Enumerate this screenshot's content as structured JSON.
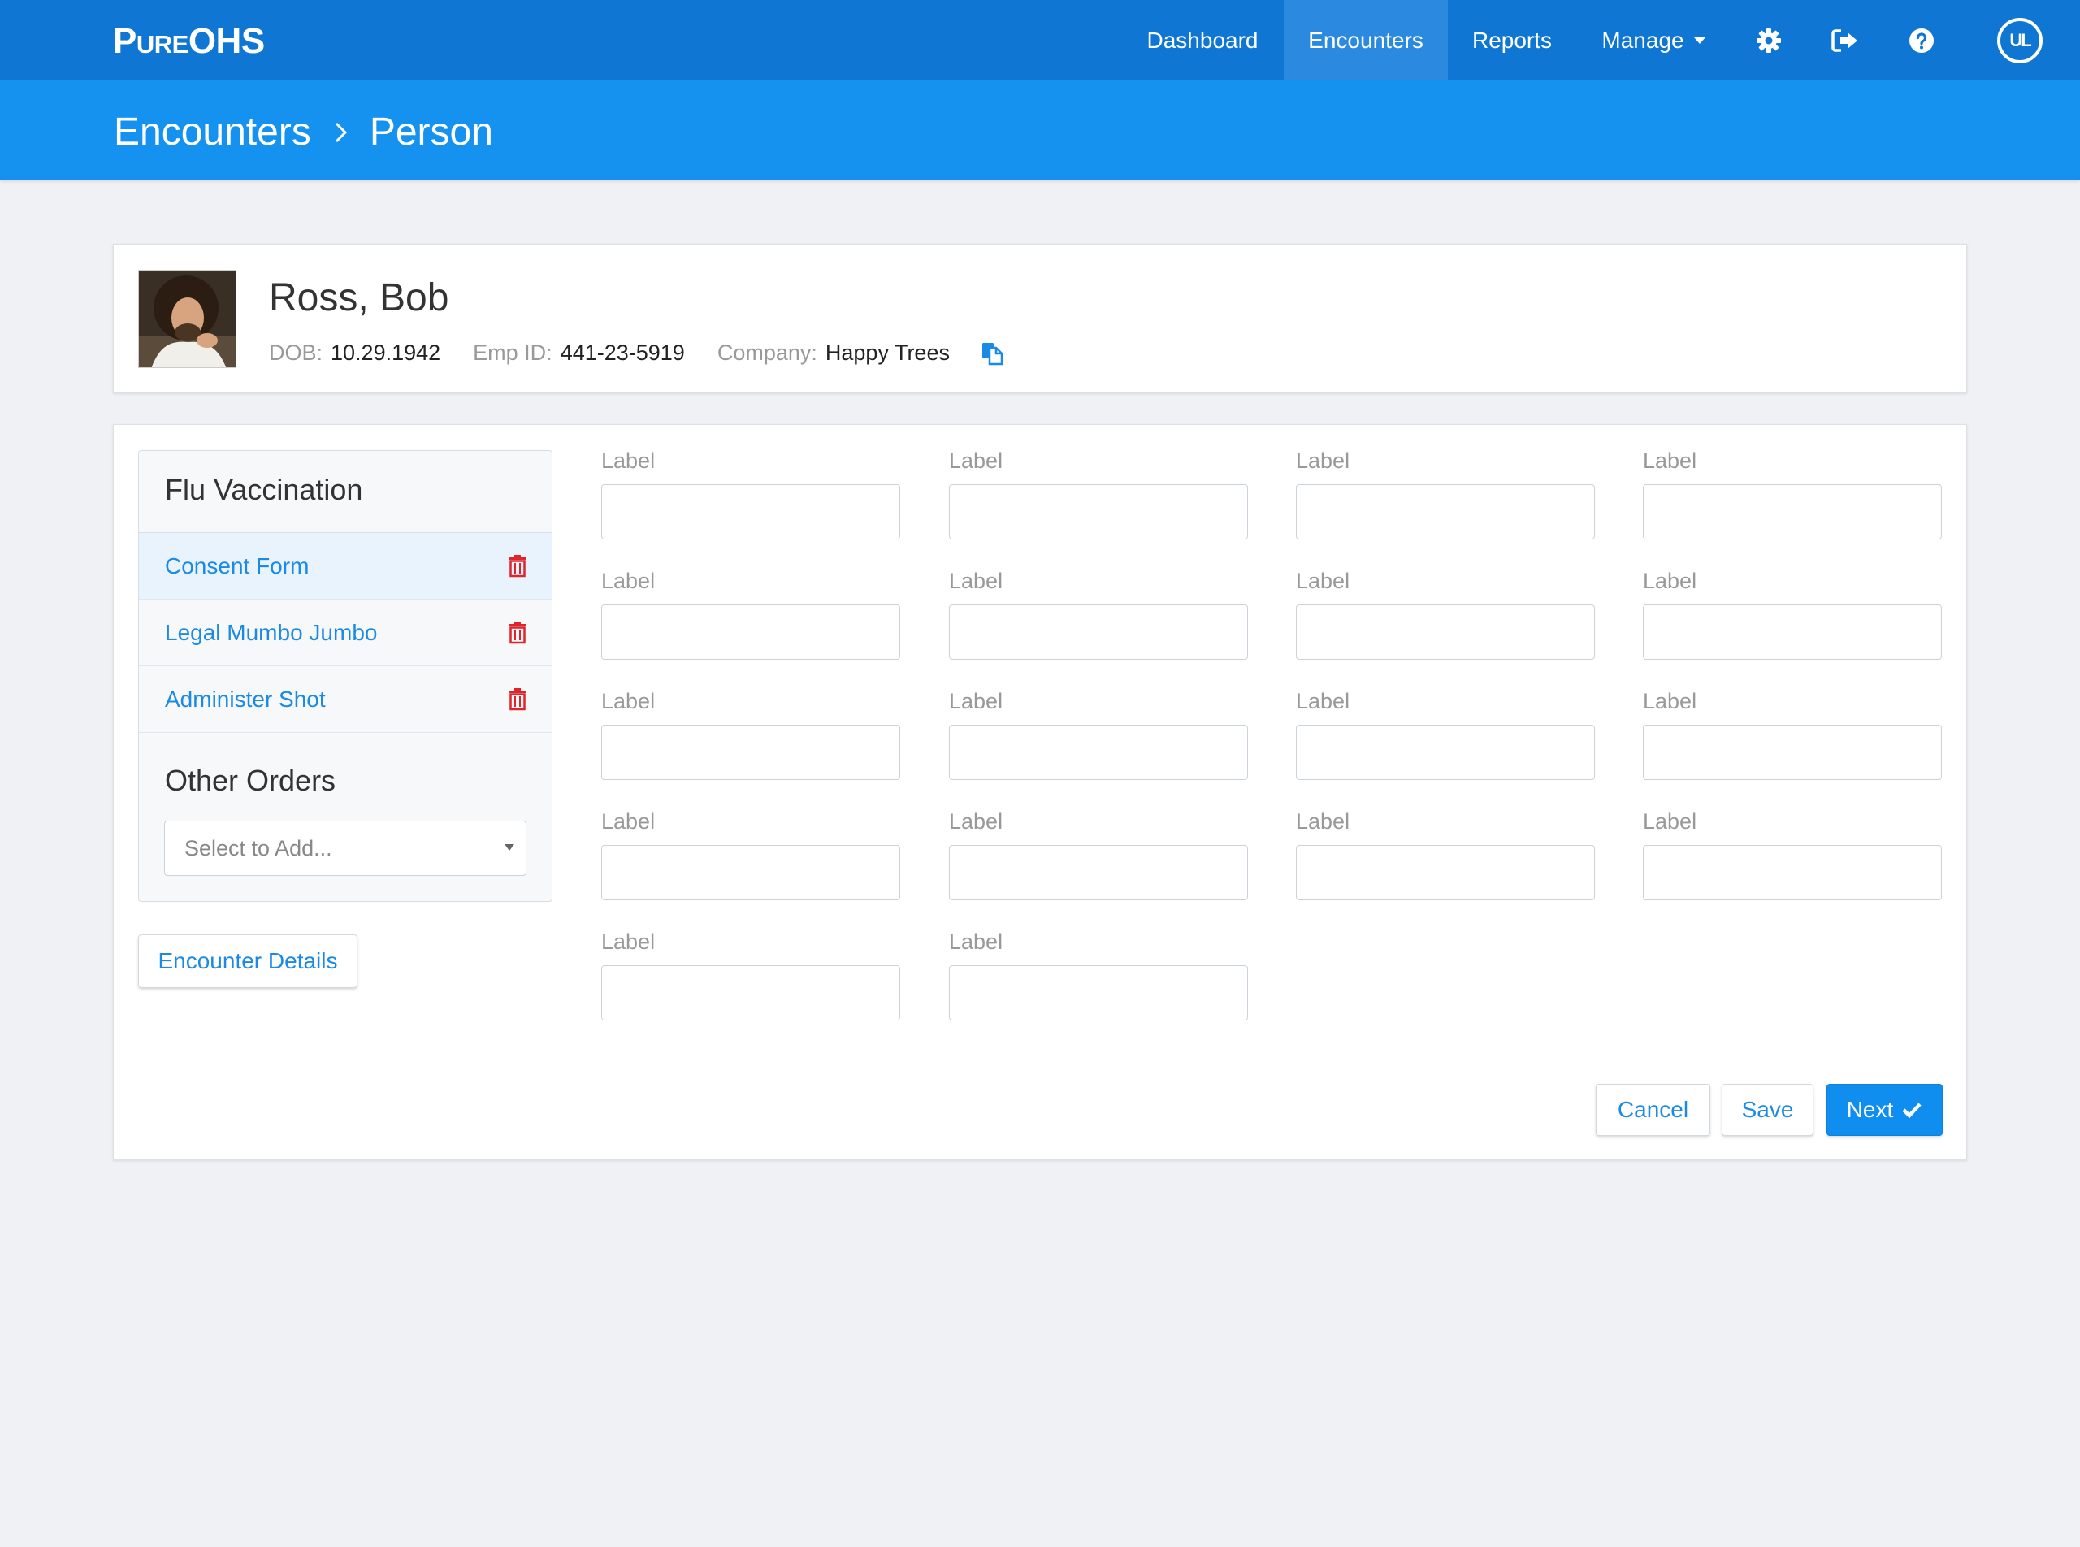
{
  "app": {
    "logo_part1": "Pure",
    "logo_part2": "OHS"
  },
  "nav": {
    "items": [
      {
        "label": "Dashboard"
      },
      {
        "label": "Encounters",
        "active": true
      },
      {
        "label": "Reports"
      },
      {
        "label": "Manage"
      }
    ],
    "icons": [
      "gear-icon",
      "sign-out-icon",
      "help-icon"
    ],
    "badge": "UL"
  },
  "breadcrumb": {
    "items": [
      "Encounters",
      "Person"
    ]
  },
  "person": {
    "name": "Ross, Bob",
    "dob_label": "DOB:",
    "dob": "10.29.1942",
    "emp_label": "Emp ID:",
    "emp_id": "441-23-5919",
    "company_label": "Company:",
    "company": "Happy Trees"
  },
  "orders": {
    "title": "Flu Vaccination",
    "items": [
      {
        "label": "Consent Form",
        "selected": true
      },
      {
        "label": "Legal Mumbo Jumbo"
      },
      {
        "label": "Administer Shot"
      }
    ],
    "other_title": "Other Orders",
    "select_placeholder": "Select to Add..."
  },
  "details_button": "Encounter Details",
  "form": {
    "fields": [
      {
        "label": "Label",
        "value": ""
      },
      {
        "label": "Label",
        "value": ""
      },
      {
        "label": "Label",
        "value": ""
      },
      {
        "label": "Label",
        "value": ""
      },
      {
        "label": "Label",
        "value": ""
      },
      {
        "label": "Label",
        "value": ""
      },
      {
        "label": "Label",
        "value": ""
      },
      {
        "label": "Label",
        "value": ""
      },
      {
        "label": "Label",
        "value": ""
      },
      {
        "label": "Label",
        "value": ""
      },
      {
        "label": "Label",
        "value": ""
      },
      {
        "label": "Label",
        "value": ""
      },
      {
        "label": "Label",
        "value": ""
      },
      {
        "label": "Label",
        "value": ""
      },
      {
        "label": "Label",
        "value": ""
      },
      {
        "label": "Label",
        "value": ""
      },
      {
        "label": "Label",
        "value": ""
      },
      {
        "label": "Label",
        "value": ""
      }
    ]
  },
  "actions": {
    "cancel": "Cancel",
    "save": "Save",
    "next": "Next"
  },
  "colors": {
    "nav_bg": "#0f77d3",
    "header_bg": "#1592f0",
    "link": "#1a8ae6",
    "danger": "#e0242b",
    "primary_button": "#0f8ef0"
  }
}
